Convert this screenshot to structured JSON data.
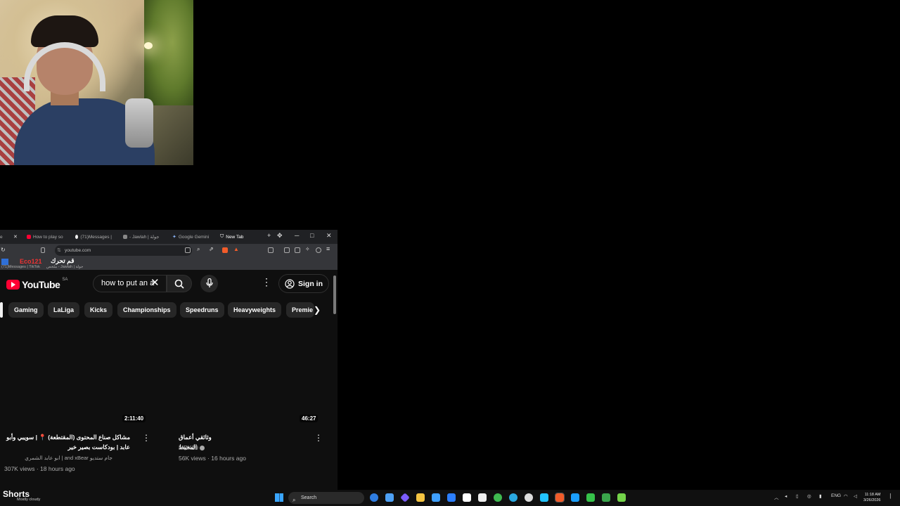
{
  "browser": {
    "tabs": [
      {
        "label": "e",
        "icon": "youtube-favicon"
      },
      {
        "label": "How to play so",
        "icon": "youtube-favicon"
      },
      {
        "label": "(71)Messages |",
        "icon": "tiktok-favicon"
      },
      {
        "label": "- Jawlah | جولة",
        "icon": "globe-favicon"
      },
      {
        "label": "Google Gemini",
        "icon": "gemini-favicon"
      },
      {
        "label": "New Tab",
        "icon": "shield-favicon"
      }
    ],
    "window_controls": {
      "minimize": "─",
      "maximize": "□",
      "close": "✕"
    },
    "url": "youtube.com",
    "bookmarks": [
      {
        "label": "(71)Messages | TikTok"
      },
      {
        "label": "ملخص - Jawlah | جولة"
      }
    ],
    "overlay_text": "قم تحرك",
    "overlay_tag": "Eco121"
  },
  "youtube": {
    "logo_text": "YouTube",
    "region": "SA",
    "search_value": "how to put an a",
    "signin_label": "Sign in",
    "chips": [
      "Gaming",
      "LaLiga",
      "Kicks",
      "Championships",
      "Speedruns",
      "Heavyweights",
      "Premie"
    ],
    "videos": [
      {
        "duration": "2:11:40",
        "title": "مشاكل صناع المحتوى (المقتطعة) 📍 | سويبي وأبو عابد | بودكاست بصير خير",
        "channel": "جام ستديو and xBear | ابو عابد الشمري",
        "stats": "307K views · 18 hours ago"
      },
      {
        "duration": "46:27",
        "title": "وثائقي أعماق المحيط",
        "channel": "MEX19",
        "stats": "56K views · 16 hours ago"
      }
    ]
  },
  "taskbar": {
    "shorts_label": "Shorts",
    "weather": "Mostly cloudy",
    "search_placeholder": "Search",
    "language": "ENG",
    "time": "11:18 AM",
    "date": "3/26/2026",
    "app_colors": [
      "#2f7de1",
      "#4ea1f5",
      "#7b5cff",
      "#3fa0ff",
      "#f5c542",
      "#2c7fff",
      "#ffffff",
      "#3fb950",
      "#2aa8e0",
      "#ffffff",
      "#22c3ff",
      "#f25c2a",
      "#1b9fff",
      "#36c24a",
      "#3aa54b",
      "#74d34a"
    ]
  }
}
